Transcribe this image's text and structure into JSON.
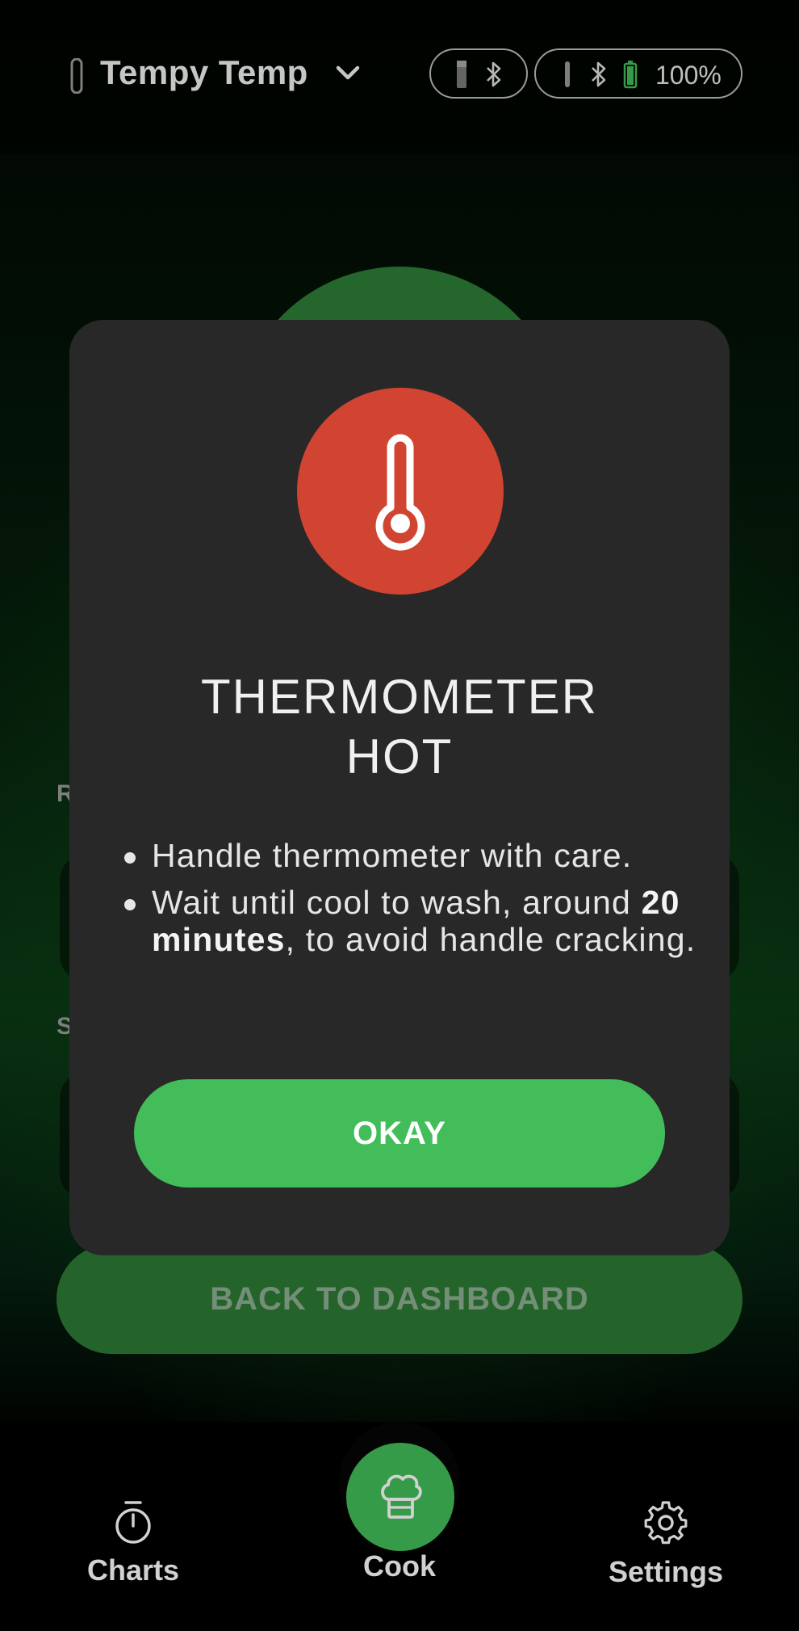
{
  "header": {
    "device_name": "Tempy Temp",
    "battery_percent": "100%"
  },
  "background": {
    "letters": [
      "R",
      "S"
    ],
    "back_button_label": "BACK TO DASHBOARD"
  },
  "modal": {
    "title_line1": "THERMOMETER",
    "title_line2": "HOT",
    "bullet1": "Handle thermometer with care.",
    "bullet2_pre": "Wait until cool to wash, around ",
    "bullet2_bold": "20 minutes",
    "bullet2_post": ", to avoid handle cracking.",
    "okay_label": "OKAY"
  },
  "nav": {
    "charts_label": "Charts",
    "cook_label": "Cook",
    "settings_label": "Settings"
  },
  "colors": {
    "accent_green": "#43bd5a",
    "alert_red": "#d14431",
    "modal_bg": "#282828"
  },
  "icons": [
    "probe-icon",
    "chevron-down-icon",
    "bluetooth-icon",
    "battery-icon",
    "thermometer-icon",
    "stopwatch-icon",
    "chef-hat-icon",
    "gear-icon"
  ]
}
